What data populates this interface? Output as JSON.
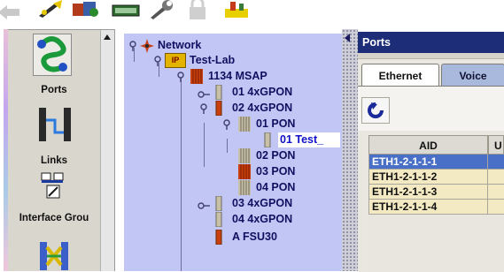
{
  "toolbar": {
    "buttons": [
      {
        "icon": "back-arrow-icon",
        "enabled": false
      },
      {
        "icon": "wand-icon",
        "enabled": true
      },
      {
        "icon": "mixed-tools-icon",
        "enabled": true
      },
      {
        "icon": "card-icon",
        "enabled": true
      },
      {
        "icon": "wrench-icon",
        "enabled": true
      },
      {
        "icon": "lock-icon",
        "enabled": false
      },
      {
        "icon": "rack-icon",
        "enabled": true
      }
    ]
  },
  "sidebar": {
    "items": [
      {
        "label": "Ports",
        "icon": "ports-icon",
        "selected": true
      },
      {
        "label": "Links",
        "icon": "links-icon"
      },
      {
        "label": "Interface Grou",
        "icon": "interface-group-icon"
      },
      {
        "label": "",
        "icon": "cross-connect-icon"
      }
    ]
  },
  "tree": {
    "nodes": [
      {
        "label": "Network",
        "icon": "network-icon",
        "expander": "expanded"
      },
      {
        "label": "Test-Lab",
        "icon": "ip-site-icon",
        "badge": "IP",
        "expander": "expanded"
      },
      {
        "label": "1134 MSAP",
        "icon": "chassis-icon",
        "expander": "expanded"
      },
      {
        "label": "01 4xGPON",
        "icon": "card-slot-icon",
        "expander": "collapsed"
      },
      {
        "label": "02 4xGPON",
        "icon": "card-slot-icon",
        "expander": "expanded"
      },
      {
        "label": "01 PON",
        "icon": "pon-port-icon",
        "expander": "expanded"
      },
      {
        "label": "01 Test_",
        "icon": "ont-icon",
        "selected": true
      },
      {
        "label": "02 PON",
        "icon": "pon-port-icon"
      },
      {
        "label": "03 PON",
        "icon": "pon-port-icon"
      },
      {
        "label": "04 PON",
        "icon": "pon-port-icon"
      },
      {
        "label": "03 4xGPON",
        "icon": "card-slot-icon",
        "expander": "collapsed"
      },
      {
        "label": "04 4xGPON",
        "icon": "card-slot-icon"
      },
      {
        "label": "A FSU30",
        "icon": "card-slot-icon"
      }
    ]
  },
  "ports": {
    "title": "Ports",
    "tabs": [
      {
        "label": "Ethernet",
        "active": true
      },
      {
        "label": "Voice",
        "active": false
      }
    ],
    "refresh_icon": "refresh-icon",
    "table": {
      "columns": [
        "AID",
        "U"
      ],
      "rows": [
        {
          "aid": "ETH1-2-1-1-1",
          "selected": true
        },
        {
          "aid": "ETH1-2-1-1-2"
        },
        {
          "aid": "ETH1-2-1-1-3"
        },
        {
          "aid": "ETH1-2-1-1-4"
        }
      ]
    }
  },
  "colors": {
    "tree_bg": "#c2c6f4",
    "title_bar": "#1d2d78",
    "selected_row": "#4a6fc6",
    "row_bg": "#f3eac4"
  }
}
